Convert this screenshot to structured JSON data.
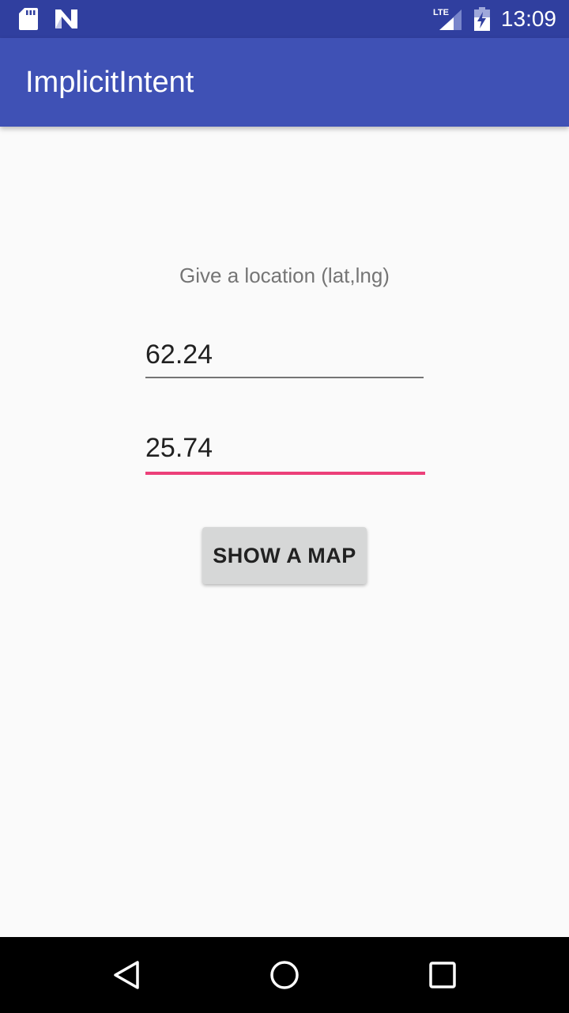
{
  "status_bar": {
    "time": "13:09",
    "network_label": "LTE",
    "icons": [
      "sd-card-icon",
      "n-notification-icon",
      "lte-signal-icon",
      "battery-charging-icon"
    ]
  },
  "app_bar": {
    "title": "ImplicitIntent"
  },
  "main": {
    "prompt": "Give a location (lat,lng)",
    "latitude_value": "62.24",
    "longitude_value": "25.74",
    "show_map_label": "SHOW A MAP"
  },
  "nav_bar": {
    "icons": [
      "back-icon",
      "home-icon",
      "recents-icon"
    ]
  },
  "colors": {
    "status_bar": "#303f9f",
    "app_bar": "#3f51b5",
    "accent": "#ec407a",
    "background": "#fafafa",
    "button": "#d6d7d7"
  }
}
